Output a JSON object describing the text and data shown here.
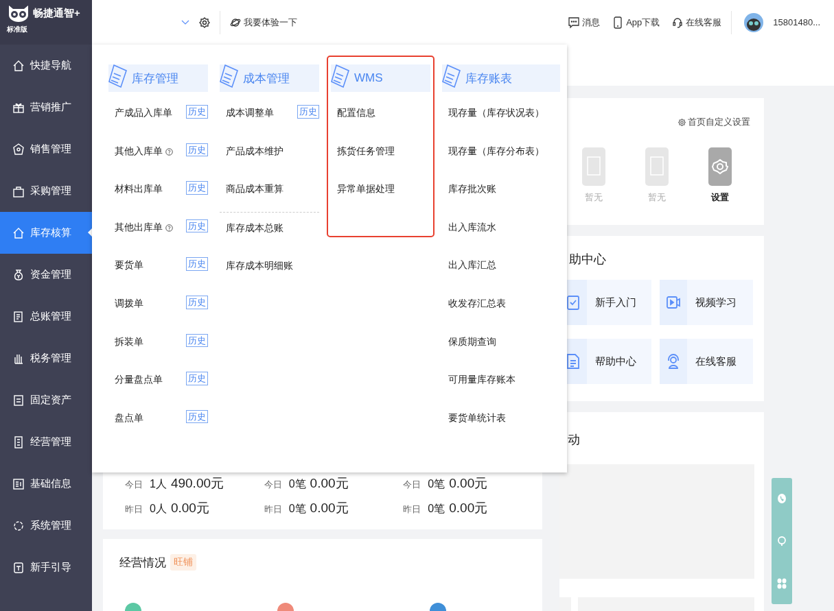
{
  "brand": {
    "name": "畅捷通智+",
    "edition": "标准版"
  },
  "header": {
    "try_link": "我要体验一下",
    "actions": [
      {
        "label": "消息",
        "kind": "message"
      },
      {
        "label": "App下载",
        "kind": "phone"
      },
      {
        "label": "在线客服",
        "kind": "headset"
      }
    ],
    "user": "15801480..."
  },
  "sidebar": {
    "items": [
      {
        "label": "快捷导航",
        "kind": "home",
        "selected": false
      },
      {
        "label": "营销推广",
        "kind": "gift",
        "selected": false
      },
      {
        "label": "销售管理",
        "kind": "tag",
        "selected": false
      },
      {
        "label": "采购管理",
        "kind": "bag",
        "selected": false
      },
      {
        "label": "库存核算",
        "kind": "house",
        "selected": true
      },
      {
        "label": "资金管理",
        "kind": "money",
        "selected": false
      },
      {
        "label": "总账管理",
        "kind": "ledger",
        "selected": false
      },
      {
        "label": "税务管理",
        "kind": "hand",
        "selected": false
      },
      {
        "label": "固定资产",
        "kind": "asset",
        "selected": false
      },
      {
        "label": "经营管理",
        "kind": "doc",
        "selected": false
      },
      {
        "label": "基础信息",
        "kind": "info",
        "selected": false
      },
      {
        "label": "系统管理",
        "kind": "system",
        "selected": false
      },
      {
        "label": "新手引导",
        "kind": "guide",
        "selected": false
      }
    ]
  },
  "menu": {
    "groups": [
      {
        "title": "库存管理",
        "highlighted": false,
        "items": [
          {
            "label": "产成品入库单",
            "help": false,
            "badge": "历史"
          },
          {
            "label": "其他入库单",
            "help": true,
            "badge": "历史"
          },
          {
            "label": "材料出库单",
            "help": false,
            "badge": "历史"
          },
          {
            "label": "其他出库单",
            "help": true,
            "badge": "历史"
          },
          {
            "label": "要货单",
            "help": false,
            "badge": "历史"
          },
          {
            "label": "调拨单",
            "help": false,
            "badge": "历史"
          },
          {
            "label": "拆装单",
            "help": false,
            "badge": "历史"
          },
          {
            "label": "分量盘点单",
            "help": false,
            "badge": "历史"
          },
          {
            "label": "盘点单",
            "help": false,
            "badge": "历史"
          }
        ]
      },
      {
        "title": "成本管理",
        "highlighted": false,
        "items": [
          {
            "label": "成本调整单",
            "help": false,
            "badge": "历史"
          },
          {
            "label": "产品成本维护",
            "help": false
          },
          {
            "label": "商品成本重算",
            "help": false
          },
          {
            "label": "库存成本总账",
            "help": false,
            "divider_before": true
          },
          {
            "label": "库存成本明细账",
            "help": false
          }
        ]
      },
      {
        "title": "WMS",
        "highlighted": true,
        "items": [
          {
            "label": "配置信息",
            "help": false
          },
          {
            "label": "拣货任务管理",
            "help": false
          },
          {
            "label": "异常单据处理",
            "help": false
          }
        ]
      },
      {
        "title": "库存账表",
        "highlighted": false,
        "items": [
          {
            "label": "现存量（库存状况表）",
            "help": false
          },
          {
            "label": "现存量（库存分布表）",
            "help": false
          },
          {
            "label": "库存批次账",
            "help": false
          },
          {
            "label": "出入库流水",
            "help": false
          },
          {
            "label": "出入库汇总",
            "help": false
          },
          {
            "label": "收发存汇总表",
            "help": false
          },
          {
            "label": "保质期查询",
            "help": false
          },
          {
            "label": "可用量库存账本",
            "help": false
          },
          {
            "label": "要货单统计表",
            "help": false
          }
        ]
      }
    ]
  },
  "stats": [
    {
      "rows": [
        {
          "label": "今日",
          "count": "1人",
          "amount": "490.00元"
        },
        {
          "label": "昨日",
          "count": "0人",
          "amount": "0.00元"
        }
      ]
    },
    {
      "rows": [
        {
          "label": "今日",
          "count": "0笔",
          "amount": "0.00元"
        },
        {
          "label": "昨日",
          "count": "0笔",
          "amount": "0.00元"
        }
      ]
    },
    {
      "rows": [
        {
          "label": "今日",
          "count": "0笔",
          "amount": "0.00元"
        },
        {
          "label": "昨日",
          "count": "0笔",
          "amount": "0.00元"
        }
      ]
    }
  ],
  "business": {
    "title": "经营情况",
    "tag": "旺铺"
  },
  "shortcuts": {
    "settings_link": "首页自定义设置",
    "items": [
      {
        "label": "暂无",
        "kind": "empty"
      },
      {
        "label": "暂无",
        "kind": "empty"
      },
      {
        "label": "设置",
        "kind": "settings"
      }
    ]
  },
  "help": {
    "title": "助中心",
    "tiles": [
      {
        "label": "新手入门",
        "kind": "guide"
      },
      {
        "label": "视频学习",
        "kind": "video"
      },
      {
        "label": "帮助中心",
        "kind": "doc"
      },
      {
        "label": "在线客服",
        "kind": "service"
      }
    ]
  },
  "activity": {
    "title": "动"
  }
}
